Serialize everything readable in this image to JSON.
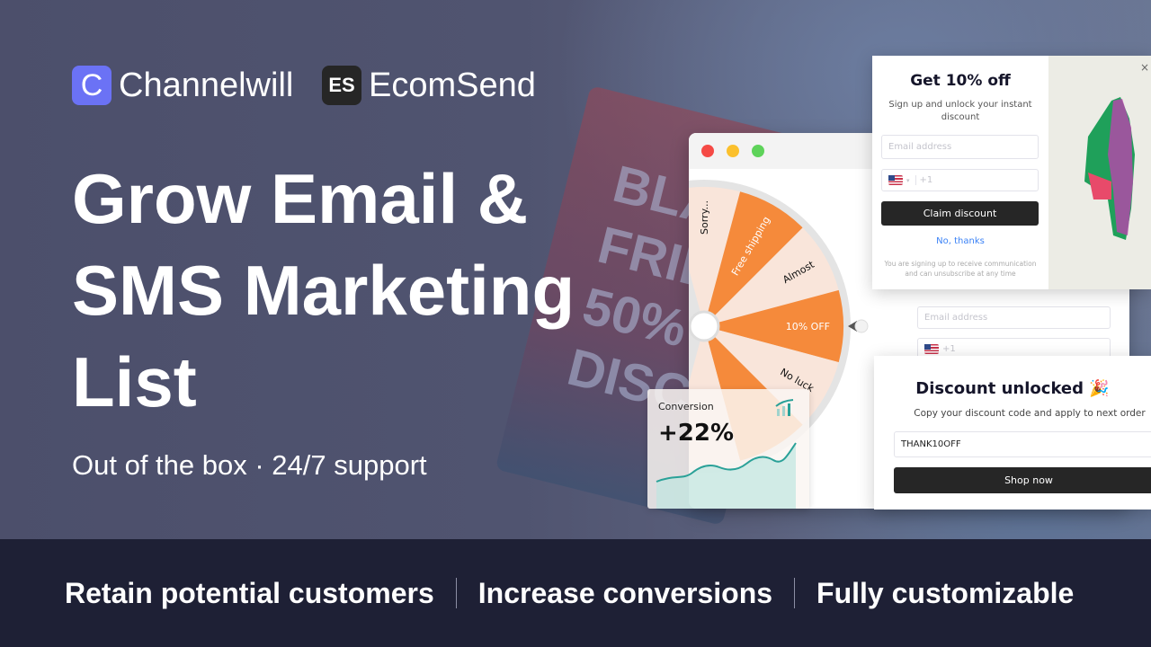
{
  "brands": [
    {
      "name": "Channelwill",
      "mark": "C",
      "color": "#6b72f5"
    },
    {
      "name": "EcomSend",
      "mark": "ES",
      "color": "#262626"
    }
  ],
  "headline": "Grow Email & SMS Marketing List",
  "subtitle": "Out of the box · 24/7  support",
  "background_sign": "BLACK FRIDAY 50% DISCOUNT",
  "features": [
    "Retain potential customers",
    "Increase conversions",
    "Fully customizable"
  ],
  "window": {
    "dots": [
      "#f54a45",
      "#fbc02d",
      "#5ed35a"
    ]
  },
  "wheel": {
    "slices": [
      {
        "label": "Sorry...",
        "color": "#f9e5da",
        "angle": -90
      },
      {
        "label": "Free shipping",
        "color": "#f58a3b",
        "angle": -60
      },
      {
        "label": "Almost",
        "color": "#f9e5da",
        "angle": -30
      },
      {
        "label": "10% OFF",
        "color": "#f58a3b",
        "angle": 0
      },
      {
        "label": "No luck",
        "color": "#f9e5da",
        "angle": 30
      },
      {
        "label": "",
        "color": "#f58a3b",
        "angle": 60
      },
      {
        "label": "",
        "color": "#f9e5da",
        "angle": 90
      }
    ]
  },
  "signup_popup": {
    "title": "Get 10% off",
    "text": "Sign up and unlock your instant discount",
    "email_placeholder": "Email address",
    "phone_placeholder": "+1",
    "button": "Claim discount",
    "decline": "No, thanks",
    "legal": "You are signing up to receive communication and can unsubscribe at any time",
    "close": "×"
  },
  "background_form": {
    "email_placeholder": "Email address",
    "phone_placeholder": "+1"
  },
  "unlocked_popup": {
    "title": "Discount unlocked",
    "emoji": "🎉",
    "text": "Copy your discount code and apply to next order",
    "code": "THANK10OFF",
    "button": "Shop now"
  },
  "conversion": {
    "label": "Conversion",
    "value": "+22%",
    "accent": "#2aa198"
  }
}
